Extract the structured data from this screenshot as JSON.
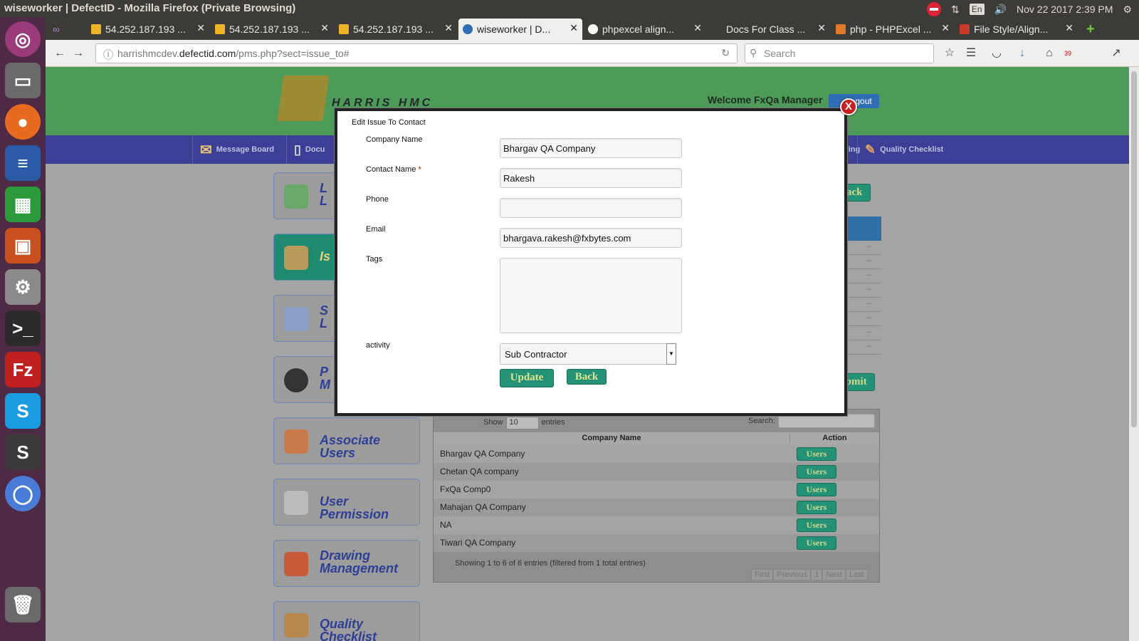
{
  "os": {
    "window_title": "wiseworker | DefectID - Mozilla Firefox (Private Browsing)",
    "lang": "En",
    "datetime": "Nov 22 2017  2:39 PM"
  },
  "tabs": [
    {
      "label": "54.252.187.193 ..."
    },
    {
      "label": "54.252.187.193 ..."
    },
    {
      "label": "54.252.187.193 ..."
    },
    {
      "label": "wiseworker | D..."
    },
    {
      "label": "phpexcel align..."
    },
    {
      "label": "Docs For Class ..."
    },
    {
      "label": "php - PHPExcel ..."
    },
    {
      "label": "File Style/Align..."
    }
  ],
  "nav": {
    "url_host": "harrishmcdev.",
    "url_domain": "defectid.com",
    "url_path": "/pms.php?sect=issue_to#",
    "search_placeholder": "Search",
    "badge": "39"
  },
  "site": {
    "brand": "HARRIS HMC",
    "welcome": "Welcome FxQa Manager",
    "logout": "Logout",
    "menu": [
      {
        "label": "Message Board"
      },
      {
        "label": "Docu"
      },
      {
        "label": "itoring"
      },
      {
        "label": "Quality Checklist"
      }
    ],
    "side": [
      {
        "label": "L\nL"
      },
      {
        "label": "Is"
      },
      {
        "label": "S\nL"
      },
      {
        "label": "P\nM"
      },
      {
        "label": "Associate Users"
      },
      {
        "label": "User Permission"
      },
      {
        "label": "Drawing Management"
      },
      {
        "label": "Quality Checklist"
      }
    ],
    "back": "Back",
    "submit": "Submit"
  },
  "table": {
    "show": "Show",
    "entries_value": "10",
    "entries": "entries",
    "search_label": "Search:",
    "col_company": "Company Name",
    "col_action": "Action",
    "rows": [
      {
        "company": "Bhargav QA Company",
        "action": "Users"
      },
      {
        "company": "Chetan QA company",
        "action": "Users"
      },
      {
        "company": "FxQa Comp0",
        "action": "Users"
      },
      {
        "company": "Mahajan QA Company",
        "action": "Users"
      },
      {
        "company": "NA",
        "action": "Users"
      },
      {
        "company": "Tiwari QA Company",
        "action": "Users"
      }
    ],
    "info": "Showing 1 to 6 of 6 entries (filtered from 1 total entries)",
    "pager": [
      "First",
      "Previous",
      "1",
      "Next",
      "Last"
    ]
  },
  "modal": {
    "title": "Edit Issue To Contact",
    "close": "X",
    "company_label": "Company Name",
    "company_value": "Bhargav QA Company",
    "contact_label": "Contact Name",
    "contact_req": "*",
    "contact_value": "Rakesh",
    "phone_label": "Phone",
    "phone_value": "",
    "email_label": "Email",
    "email_value": "bhargava.rakesh@fxbytes.com",
    "tags_label": "Tags",
    "activity_label": "activity",
    "activity_value": "Sub Contractor",
    "update": "Update",
    "back": "Back"
  }
}
